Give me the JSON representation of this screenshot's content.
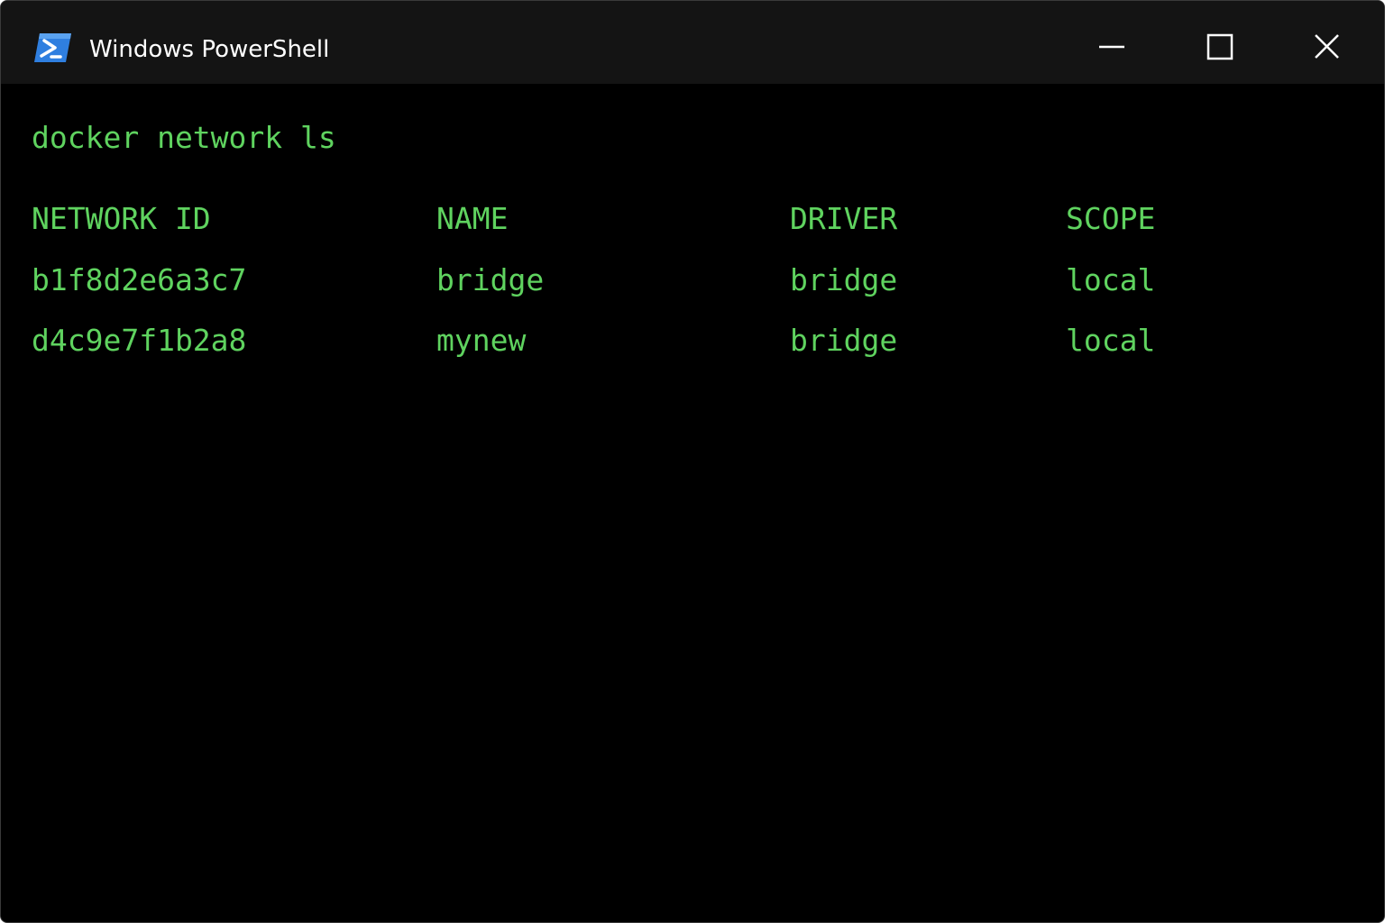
{
  "window": {
    "title": "Windows PowerShell",
    "icon": "powershell-icon",
    "controls": [
      "minimize-icon",
      "maximize-icon",
      "close-icon"
    ]
  },
  "colors": {
    "terminal_text": "#5fd35f",
    "terminal_bg": "#000000",
    "titlebar_bg": "#141414",
    "icon_blue": "#2f7fe0"
  },
  "terminal": {
    "command": "docker network ls",
    "headers": [
      "NETWORK ID",
      "NAME",
      "DRIVER",
      "SCOPE"
    ],
    "rows": [
      [
        "b1f8d2e6a3c7",
        "bridge",
        "bridge",
        "local"
      ],
      [
        "d4c9e7f1b2a8",
        "mynew",
        "bridge",
        "local"
      ]
    ]
  }
}
